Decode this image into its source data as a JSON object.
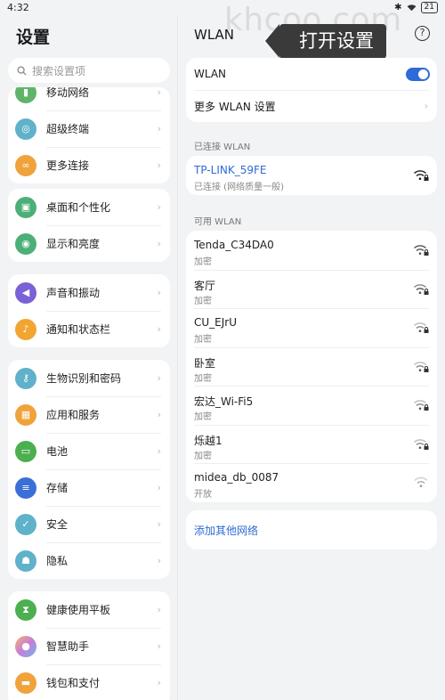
{
  "status": {
    "time": "4:32",
    "battery": "21"
  },
  "watermark": "khcoo.com",
  "left": {
    "title": "设置",
    "search_placeholder": "搜索设置项",
    "groups": [
      {
        "items": [
          {
            "label": "移动网络",
            "icon": "mobile-network-icon",
            "color": "#5fb46a"
          },
          {
            "label": "超级终端",
            "icon": "super-device-icon",
            "color": "#5fb2c9"
          },
          {
            "label": "更多连接",
            "icon": "link-icon",
            "color": "#f0a23b"
          }
        ]
      },
      {
        "items": [
          {
            "label": "桌面和个性化",
            "icon": "wallpaper-icon",
            "color": "#4caf78"
          },
          {
            "label": "显示和亮度",
            "icon": "eye-icon",
            "color": "#4caf78"
          }
        ]
      },
      {
        "items": [
          {
            "label": "声音和振动",
            "icon": "speaker-icon",
            "color": "#7b61d6"
          },
          {
            "label": "通知和状态栏",
            "icon": "bell-icon",
            "color": "#f2a532"
          }
        ]
      },
      {
        "items": [
          {
            "label": "生物识别和密码",
            "icon": "key-icon",
            "color": "#5fb2c9"
          },
          {
            "label": "应用和服务",
            "icon": "apps-icon",
            "color": "#f0a23b"
          },
          {
            "label": "电池",
            "icon": "battery-icon",
            "color": "#4caf50"
          },
          {
            "label": "存储",
            "icon": "storage-icon",
            "color": "#3a6fd8"
          },
          {
            "label": "安全",
            "icon": "shield-icon",
            "color": "#5fb2c9"
          },
          {
            "label": "隐私",
            "icon": "privacy-icon",
            "color": "#5fb2c9"
          }
        ]
      },
      {
        "items": [
          {
            "label": "健康使用平板",
            "icon": "hourglass-icon",
            "color": "#4caf50"
          },
          {
            "label": "智慧助手",
            "icon": "assistant-icon",
            "color": "#c77dd8"
          },
          {
            "label": "钱包和支付",
            "icon": "wallet-icon",
            "color": "#f0a23b"
          }
        ]
      }
    ]
  },
  "right": {
    "title": "WLAN",
    "tooltip": "打开设置",
    "wlan_label": "WLAN",
    "wlan_enabled": true,
    "more_settings": "更多 WLAN 设置",
    "connected_section": "已连接 WLAN",
    "connected": {
      "ssid": "TP-LINK_59FE",
      "status": "已连接 (网络质量一般)"
    },
    "available_section": "可用 WLAN",
    "networks": [
      {
        "ssid": "Tenda_C34DA0",
        "security": "加密",
        "locked": true
      },
      {
        "ssid": "客厅",
        "security": "加密",
        "locked": true
      },
      {
        "ssid": "CU_EJrU",
        "security": "加密",
        "locked": true
      },
      {
        "ssid": "卧室",
        "security": "加密",
        "locked": true
      },
      {
        "ssid": "宏达_Wi-Fi5",
        "security": "加密",
        "locked": true
      },
      {
        "ssid": "烁越1",
        "security": "加密",
        "locked": true
      },
      {
        "ssid": "midea_db_0087",
        "security": "开放",
        "locked": false
      }
    ],
    "add_network": "添加其他网络"
  }
}
